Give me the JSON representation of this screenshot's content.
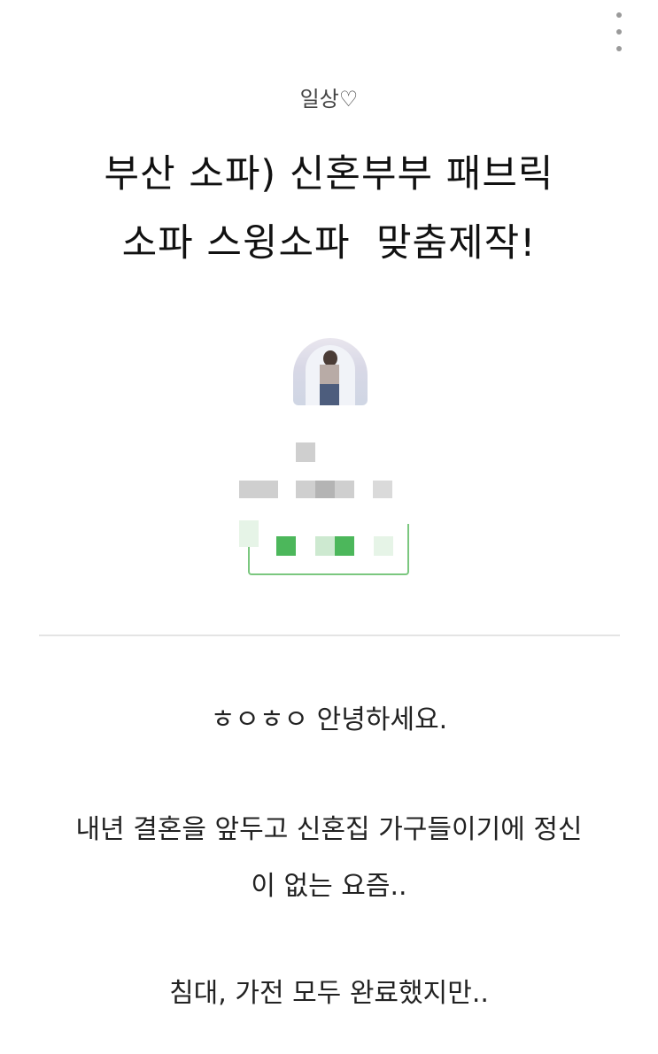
{
  "post": {
    "category": "일상♡",
    "title_line1": "부산 소파) 신혼부부 패브릭",
    "title_line2": "소파 스윙소파  맞춤제작!",
    "paragraph1": "ㅎㅇㅎㅇ 안녕하세요.",
    "paragraph2_line1": "내년 결혼을 앞두고 신혼집 가구들이기에 정신",
    "paragraph2_line2": "이 없는 요즘..",
    "paragraph3": "침대, 가전 모두 완료했지만.."
  },
  "colors": {
    "accent_green": "#4cb75b",
    "divider": "#e4e4e4"
  },
  "icons": {
    "menu": "more-vertical-icon"
  }
}
